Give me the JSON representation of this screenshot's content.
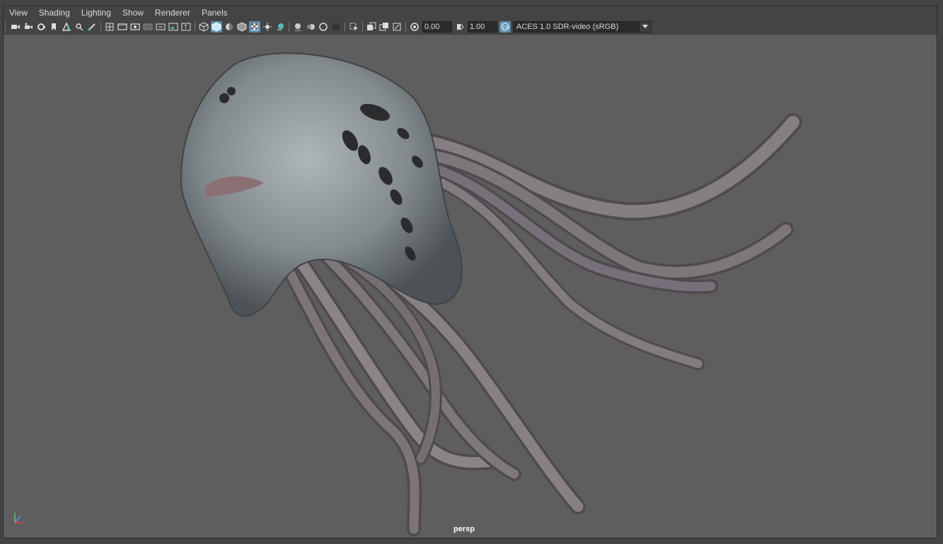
{
  "menubar": {
    "items": [
      "View",
      "Shading",
      "Lighting",
      "Show",
      "Renderer",
      "Panels"
    ]
  },
  "toolbar": {
    "exposure_value": "0.00",
    "gamma_value": "1.00",
    "color_space": "ACES 1.0 SDR-video (sRGB)"
  },
  "viewport": {
    "camera_label": "persp",
    "axis": {
      "x": "x",
      "y": "y",
      "z": "z"
    }
  },
  "colors": {
    "background": "#5e5e5e",
    "panel": "#444444",
    "active_icon": "#5b8fb0"
  }
}
